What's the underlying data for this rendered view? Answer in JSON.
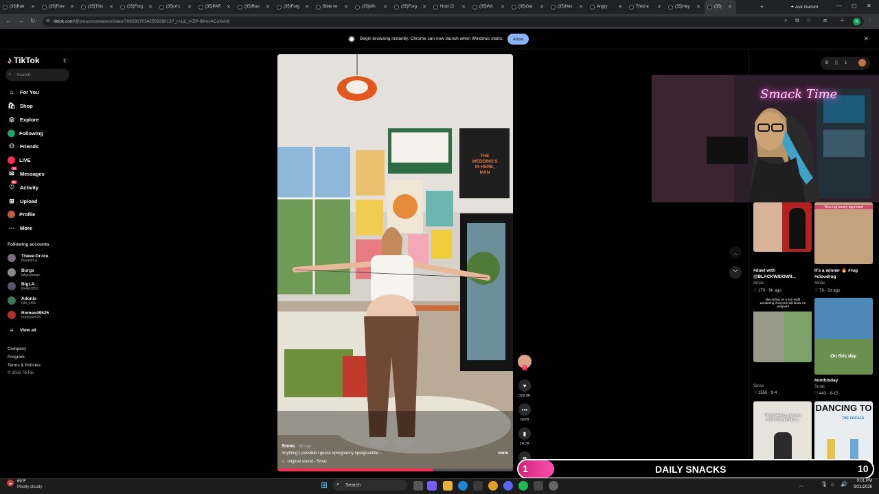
{
  "browser": {
    "tabs": [
      {
        "label": "(35)Patr"
      },
      {
        "label": "(35)Fore"
      },
      {
        "label": "(35)This"
      },
      {
        "label": "(35)Forg"
      },
      {
        "label": "(35)of c"
      },
      {
        "label": "(35)PAR"
      },
      {
        "label": "(35)Rou"
      },
      {
        "label": "(35)Forg"
      },
      {
        "label": "Bible ve"
      },
      {
        "label": "(35)Wh"
      },
      {
        "label": "(35)Forg"
      },
      {
        "label": "Hold Cl"
      },
      {
        "label": "(35)Wit"
      },
      {
        "label": "(35)Gar"
      },
      {
        "label": "(35)Hov"
      },
      {
        "label": "Angry"
      },
      {
        "label": "Third e"
      },
      {
        "label": "(35)Hey"
      },
      {
        "label": "(35)"
      }
    ],
    "new_tab": "+",
    "ask_gemini": "Ask Gemini",
    "url_host": "tiktok.com",
    "url_path": "/@smacmccreanor/video/7685917034256928013?_r=1&_t=ZP-99mvACoXen9",
    "profile_initial": "N",
    "banner_text": "Begin browsing instantly: Chrome can now launch when Windows starts.",
    "banner_button": "Allow"
  },
  "sidebar": {
    "logo": "TikTok",
    "search_placeholder": "Search",
    "nav": [
      {
        "label": "For You",
        "icon": "home-icon",
        "glyph": "⌂"
      },
      {
        "label": "Shop",
        "icon": "shop-icon",
        "glyph": "🛍"
      },
      {
        "label": "Explore",
        "icon": "explore-icon",
        "glyph": "◎"
      },
      {
        "label": "Following",
        "icon": "following-icon",
        "glyph": "●"
      },
      {
        "label": "Friends",
        "icon": "friends-icon",
        "glyph": "⚇"
      },
      {
        "label": "LIVE",
        "icon": "live-icon",
        "glyph": "●"
      },
      {
        "label": "Messages",
        "icon": "messages-icon",
        "glyph": "✉",
        "badge": "34"
      },
      {
        "label": "Activity",
        "icon": "activity-icon",
        "glyph": "♡",
        "badge": "61"
      },
      {
        "label": "Upload",
        "icon": "upload-icon",
        "glyph": "⊞"
      },
      {
        "label": "Profile",
        "icon": "profile-icon",
        "glyph": "●"
      },
      {
        "label": "More",
        "icon": "more-icon",
        "glyph": "⋯"
      }
    ],
    "following_label": "Following accounts",
    "accounts": [
      {
        "name": "Theee-Dr-Ice",
        "handle": "theeedrice",
        "color": "#7a6a7a"
      },
      {
        "name": "Burgs",
        "handle": "taliguyburgs",
        "color": "#8a8a8a"
      },
      {
        "name": "BigLA.",
        "handle": "thekid2891",
        "color": "#555566"
      },
      {
        "name": "Adonis",
        "handle": "n3o_kh0e",
        "color": "#3a7a5a"
      },
      {
        "name": "Romeo49525",
        "handle": "romeo49525",
        "color": "#b03030"
      }
    ],
    "view_all": "View all",
    "footer": [
      "Company",
      "Program",
      "Terms & Policies",
      "© 2026 TikTok"
    ]
  },
  "video": {
    "author": "Smac",
    "time_ago": "6d ago",
    "caption": "Anything's possible i guess #pregnancy #pregnantlife...",
    "more": "more",
    "sound": "original sound - Smac",
    "poster_text": "THE WEDDING'S IN HERE, MAN",
    "likes": "329.9K",
    "comments": "6978",
    "saves": "14.7K"
  },
  "recommended": [
    {
      "title": "#duet with @BLACKWIDOWII...",
      "author": "Smac",
      "stats": "170 · 9h ago"
    },
    {
      "title": "It's a winner 🔥 #rug #cloudrug",
      "author": "Smac",
      "stats": "78 · 2d ago",
      "thumb_text": "New rug bunny approved"
    },
    {
      "title": "",
      "author": "Smac",
      "stats": "1550 · 9-4",
      "thumb_text": "Me putting on a sun outfit wondering if anyone will know I'm pregnant"
    },
    {
      "title": "#onthisday",
      "author": "Smac",
      "stats": "443 · 8-15",
      "thumb_text": "On this day"
    },
    {
      "title": "",
      "author": "",
      "stats": "",
      "thumb_text": "Tried taking my own maternity photos..."
    },
    {
      "title": "",
      "author": "",
      "stats": "",
      "thumb_text": "DANCING TO",
      "thumb_text2": "THE VOCALS"
    }
  ],
  "webcam": {
    "neon": "Smack Time"
  },
  "overlay": {
    "left_num": "1",
    "label": "DAILY SNACKS",
    "right_num": "10"
  },
  "taskbar": {
    "temp": "69°F",
    "weather": "Mostly cloudy",
    "search": "Search",
    "time": "9:01 PM",
    "date": "9/21/2026"
  }
}
